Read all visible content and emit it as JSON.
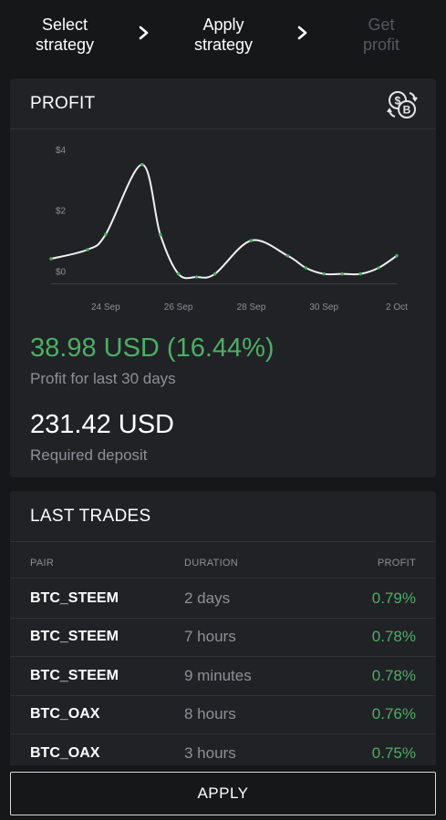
{
  "stepper": {
    "steps": [
      {
        "label_line1": "Select",
        "label_line2": "strategy",
        "active": true
      },
      {
        "label_line1": "Apply",
        "label_line2": "strategy",
        "active": true
      },
      {
        "label_line1": "Get",
        "label_line2": "profit",
        "active": false
      }
    ]
  },
  "profit_card": {
    "title": "PROFIT",
    "icon": "currency-exchange-icon",
    "profit_value": "38.98 USD (16.44%)",
    "profit_caption": "Profit for last 30 days",
    "deposit_value": "231.42 USD",
    "deposit_caption": "Required deposit"
  },
  "chart_data": {
    "type": "line",
    "y_ticks": [
      "$4",
      "$2",
      "$0"
    ],
    "x_ticks": [
      "24 Sep",
      "26 Sep",
      "28 Sep",
      "30 Sep",
      "2 Oct"
    ],
    "ylim": [
      -0.5,
      4
    ],
    "grid": false,
    "series": [
      {
        "x": [
          22.5,
          23.5,
          24.0,
          25.0,
          25.5,
          26.0,
          26.5,
          27.0,
          28.0,
          29.0,
          29.5,
          30.0,
          30.5,
          31.0,
          31.5,
          32.0
        ],
        "values": [
          0.4,
          0.7,
          1.2,
          3.5,
          1.2,
          -0.1,
          -0.2,
          -0.1,
          1.0,
          0.5,
          0.1,
          -0.1,
          -0.1,
          -0.1,
          0.1,
          0.5
        ]
      }
    ]
  },
  "trades_card": {
    "title": "LAST TRADES",
    "columns": {
      "pair": "PAIR",
      "duration": "DURATION",
      "profit": "PROFIT"
    },
    "rows": [
      {
        "pair": "BTC_STEEM",
        "duration": "2 days",
        "profit": "0.79%"
      },
      {
        "pair": "BTC_STEEM",
        "duration": "7 hours",
        "profit": "0.78%"
      },
      {
        "pair": "BTC_STEEM",
        "duration": "9 minutes",
        "profit": "0.78%"
      },
      {
        "pair": "BTC_OAX",
        "duration": "8 hours",
        "profit": "0.76%"
      },
      {
        "pair": "BTC_OAX",
        "duration": "3 hours",
        "profit": "0.75%"
      }
    ]
  },
  "apply_button": {
    "label": "APPLY"
  },
  "colors": {
    "background": "#161719",
    "card": "#202226",
    "positive": "#4caf64",
    "muted": "#8d9096"
  }
}
